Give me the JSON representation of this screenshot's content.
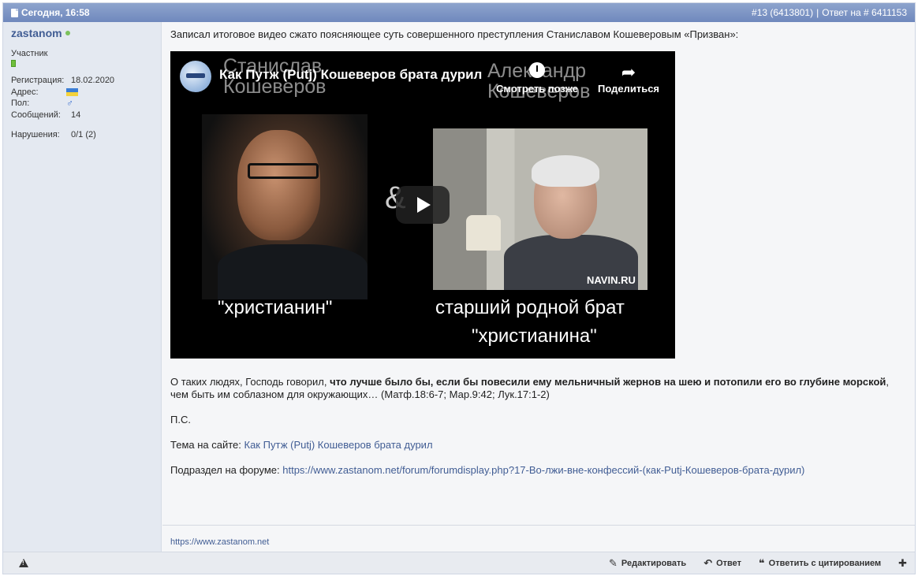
{
  "header": {
    "date": "Сегодня, 16:58",
    "post_number": "#13 (6413801)",
    "separator": "|",
    "reply_to": "Ответ на # 6411153"
  },
  "user": {
    "name": "zastanom",
    "rank": "Участник",
    "fields": [
      {
        "key": "Регистрация:",
        "value": "18.02.2020"
      },
      {
        "key": "Адрес:",
        "value": ""
      },
      {
        "key": "Пол:",
        "value": "♂"
      },
      {
        "key": "Сообщений:",
        "value": "14"
      }
    ],
    "violations_label": "Нарушения:",
    "violations_value": "0/1 (2)"
  },
  "post": {
    "intro": "Записал итоговое видео сжато поясняющее суть совершенного преступления Станиславом Кошеверовым «Призван»:",
    "video": {
      "title": "Как Путж (Putj) Кошеверов брата дурил",
      "ghost_left_1": "Станислав",
      "ghost_left_2": "Кошеверов",
      "ghost_right_1": "Александр",
      "ghost_right_2": "Кошеверов",
      "watch_later": "Смотреть позже",
      "share": "Поделиться",
      "watermark": "NAVIN.RU",
      "amp": "&",
      "caption_left": "\"христианин\"",
      "caption_right_1": "старший родной брат",
      "caption_right_2": "\"христианина\""
    },
    "quote_pre": "О таких людях, Господь говорил, ",
    "quote_bold": "что лучше было бы, если бы повесили ему мельничный жернов на шею и потопили его во глубине морской",
    "quote_post": ", чем быть им соблазном для окружающих… (Матф.18:6-7; Мар.9:42; Лук.17:1-2)",
    "ps": "П.С.",
    "topic_label": "Тема на сайте: ",
    "topic_link": "Как Путж (Putj) Кошеверов брата дурил",
    "forum_label": "Подраздел на форуме: ",
    "forum_link": "https://www.zastanom.net/forum/forumdisplay.php?17-Во-лжи-вне-конфессий-(как-Putj-Кошеверов-брата-дурил)",
    "signature": "https://www.zastanom.net"
  },
  "footer": {
    "edit": "Редактировать",
    "reply": "Ответ",
    "quote_reply": "Ответить с цитированием"
  }
}
